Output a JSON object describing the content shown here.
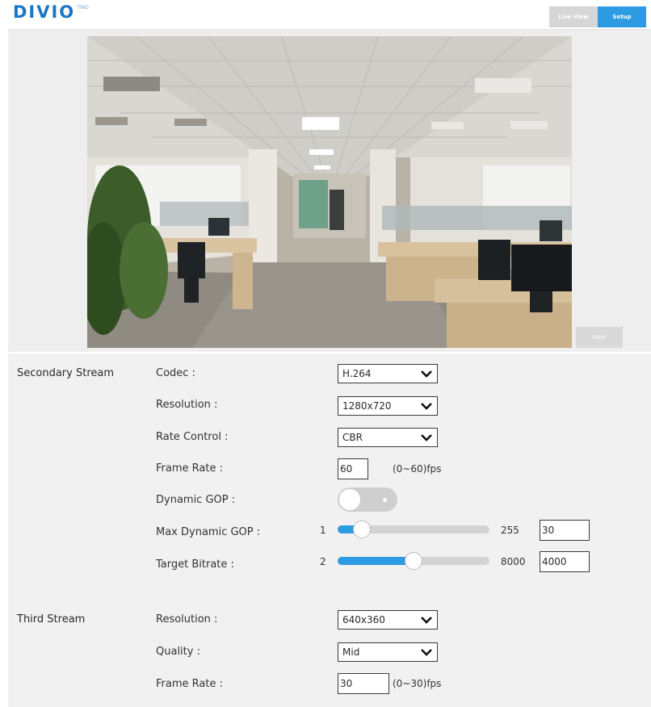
{
  "header": {
    "logo_text": "DIVIO",
    "logo_sup": "TINO",
    "nav": {
      "live_view": "Live View",
      "setup": "Setup"
    }
  },
  "preview": {
    "save_label": "Save"
  },
  "secondary": {
    "title": "Secondary Stream",
    "codec": {
      "label": "Codec :",
      "value": "H.264"
    },
    "resolution": {
      "label": "Resolution :",
      "value": "1280x720"
    },
    "rate_control": {
      "label": "Rate Control :",
      "value": "CBR"
    },
    "frame_rate": {
      "label": "Frame Rate :",
      "value": "60",
      "unit": "(0~60)fps"
    },
    "dynamic_gop": {
      "label": "Dynamic GOP :",
      "enabled": false
    },
    "max_dynamic_gop": {
      "label": "Max Dynamic GOP :",
      "min": "1",
      "max": "255",
      "value": "30",
      "level": 30
    },
    "target_bitrate": {
      "label": "Target Bitrate :",
      "min": "2",
      "max": "8000",
      "value": "4000",
      "level": 4000
    }
  },
  "third": {
    "title": "Third Stream",
    "resolution": {
      "label": "Resolution :",
      "value": "640x360"
    },
    "quality": {
      "label": "Quality :",
      "value": "Mid"
    },
    "frame_rate": {
      "label": "Frame Rate :",
      "value": "30",
      "unit": "(0~30)fps"
    }
  },
  "colors": {
    "accent": "#2d9be2",
    "logo": "#1877c9",
    "panel": "#f1f1f1"
  },
  "icons": {
    "select_arrow": "chevron-down-icon"
  }
}
